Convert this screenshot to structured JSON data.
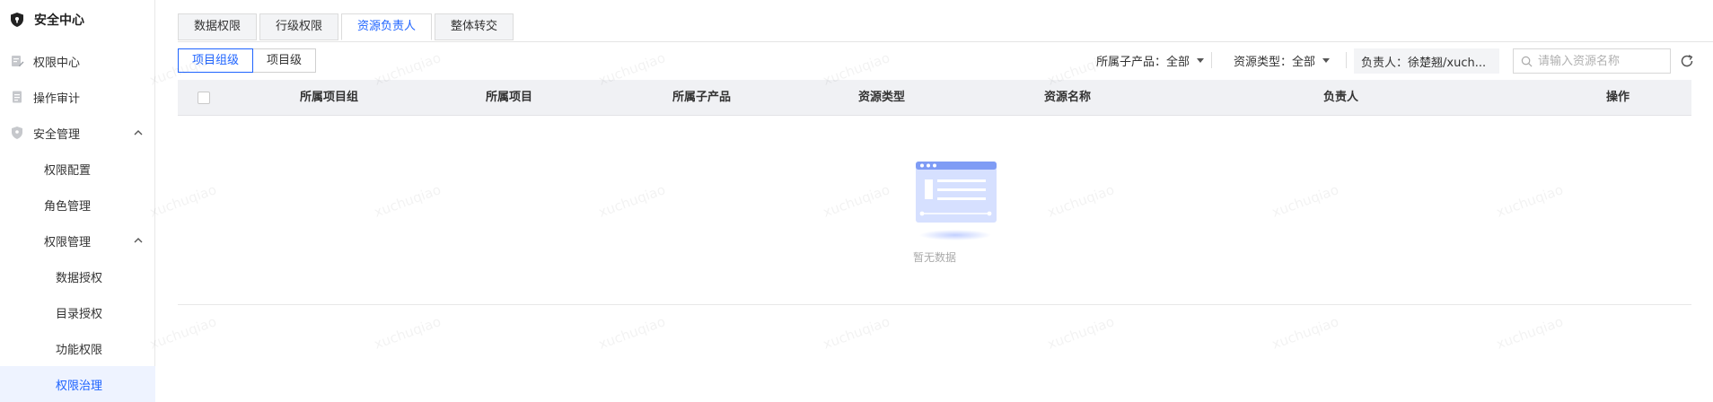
{
  "sidebar": {
    "title": "安全中心",
    "items": [
      {
        "label": "权限中心"
      },
      {
        "label": "操作审计"
      },
      {
        "label": "安全管理"
      },
      {
        "label": "权限配置"
      },
      {
        "label": "角色管理"
      },
      {
        "label": "权限管理"
      },
      {
        "label": "数据授权"
      },
      {
        "label": "目录授权"
      },
      {
        "label": "功能权限"
      },
      {
        "label": "权限治理"
      }
    ]
  },
  "tabs": [
    {
      "label": "数据权限"
    },
    {
      "label": "行级权限"
    },
    {
      "label": "资源负责人"
    },
    {
      "label": "整体转交"
    }
  ],
  "active_tab": "资源负责人",
  "segment": {
    "options": [
      {
        "label": "项目组级"
      },
      {
        "label": "项目级"
      }
    ],
    "selected": "项目组级"
  },
  "filters": {
    "subproduct": {
      "label": "所属子产品：",
      "value": "全部"
    },
    "resource_type": {
      "label": "资源类型：",
      "value": "全部"
    },
    "owner": {
      "label": "负责人：",
      "value": "徐楚翘/xuch..."
    }
  },
  "search": {
    "placeholder": "请输入资源名称",
    "value": ""
  },
  "table": {
    "columns": [
      "所属项目组",
      "所属项目",
      "所属子产品",
      "资源类型",
      "资源名称",
      "负责人",
      "操作"
    ],
    "rows": [],
    "empty_text": "暂无数据"
  },
  "watermark": "xuchuqiao",
  "colors": {
    "accent": "#1f64ff",
    "active_bg": "#eef3ff"
  }
}
